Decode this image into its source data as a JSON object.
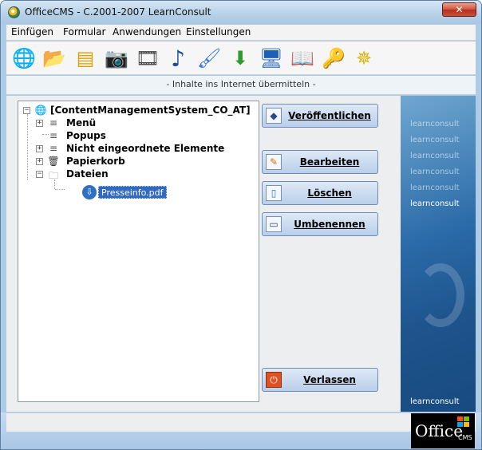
{
  "window": {
    "title": "OfficeCMS - C.2001-2007 LearnConsult",
    "close_symbol": "✕"
  },
  "menubar": {
    "items": [
      {
        "label": "Einfügen"
      },
      {
        "label": "Formular"
      },
      {
        "label": "Anwendungen"
      },
      {
        "label": "Einstellungen"
      }
    ]
  },
  "toolbar": {
    "icons": [
      {
        "name": "globe-icon",
        "glyph": "🌐"
      },
      {
        "name": "folder-icon",
        "glyph": "📂"
      },
      {
        "name": "form-icon",
        "glyph": "▤"
      },
      {
        "name": "camera-icon",
        "glyph": "📷"
      },
      {
        "name": "film-icon",
        "glyph": "🎞"
      },
      {
        "name": "music-note-icon",
        "glyph": "♪"
      },
      {
        "name": "brush-icon",
        "glyph": "🖌"
      },
      {
        "name": "download-icon",
        "glyph": "⬇"
      },
      {
        "name": "monitor-icon",
        "glyph": "🖥"
      },
      {
        "name": "book-icon",
        "glyph": "📖"
      },
      {
        "name": "key-icon",
        "glyph": "🔑"
      },
      {
        "name": "compass-icon",
        "glyph": "✵"
      }
    ]
  },
  "status_strip": {
    "text": "- Inhalte ins Internet übermitteln -"
  },
  "tree": {
    "root": "[ContentManagementSystem_CO_AT]",
    "nodes": [
      {
        "label": "Menü"
      },
      {
        "label": "Popups"
      },
      {
        "label": "Nicht eingeordnete Elemente"
      },
      {
        "label": "Papierkorb"
      },
      {
        "label": "Dateien"
      }
    ],
    "selected_file": "Presseinfo.pdf"
  },
  "buttons": {
    "publish": "Veröffentlichen",
    "edit": "Bearbeiten",
    "delete": "Löschen",
    "rename": "Umbenennen",
    "exit": "Verlassen"
  },
  "brand": {
    "logo_text": "learnconsult",
    "office_text": "Office",
    "office_sub": "CMS"
  },
  "colors": {
    "selection": "#3169c6",
    "brand_blue": "#1e548c",
    "close_red": "#c8503c"
  }
}
